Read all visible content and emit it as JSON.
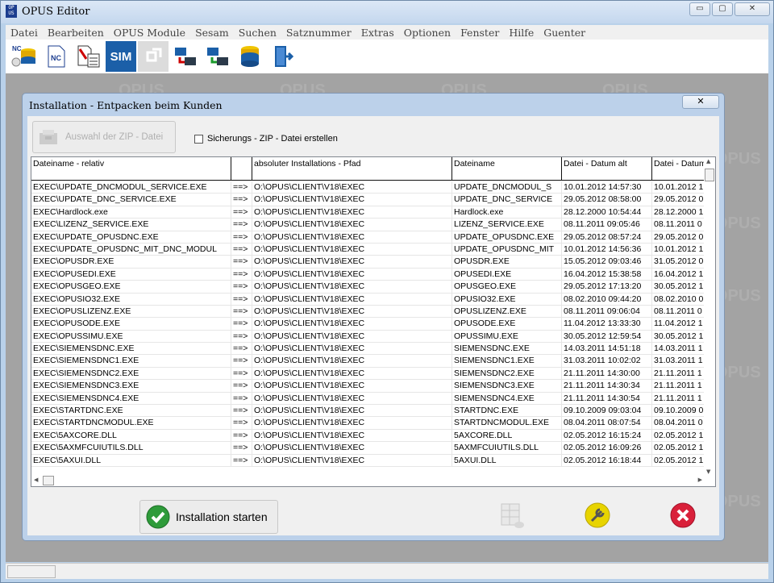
{
  "app": {
    "title": "OPUS Editor"
  },
  "window_buttons": {
    "minimize": "▭",
    "maximize": "▢",
    "close": "✕"
  },
  "menu": [
    "Datei",
    "Bearbeiten",
    "OPUS Module",
    "Sesam",
    "Suchen",
    "Satznummer",
    "Extras",
    "Optionen",
    "Fenster",
    "Hilfe",
    "Guenter"
  ],
  "toolbar": {
    "items": [
      {
        "name": "nc-database-icon",
        "label": "NC"
      },
      {
        "name": "nc-file-icon",
        "label": "NC"
      },
      {
        "name": "nc-code-icon",
        "label": ""
      },
      {
        "name": "sim-icon",
        "label": "SIM"
      },
      {
        "name": "transfer-disabled-icon",
        "label": ""
      },
      {
        "name": "network-send-icon",
        "label": ""
      },
      {
        "name": "network-receive-icon",
        "label": ""
      },
      {
        "name": "database-icon",
        "label": ""
      },
      {
        "name": "exit-icon",
        "label": ""
      }
    ]
  },
  "watermark": "OPUS",
  "dialog": {
    "title": "Installation - Entpacken beim Kunden",
    "close": "✕",
    "zip_button": "Auswahl der ZIP - Datei",
    "checkbox_label": "Sicherungs - ZIP - Datei erstellen",
    "columns": [
      "Dateiname - relativ",
      "",
      "absoluter Installations - Pfad",
      "Dateiname",
      "Datei - Datum alt",
      "Datei - Datum"
    ],
    "rows": [
      [
        "EXEC\\UPDATE_DNCMODUL_SERVICE.EXE",
        "==>",
        "O:\\OPUS\\CLIENT\\V18\\EXEC",
        "UPDATE_DNCMODUL_S",
        "10.01.2012  14:57:30",
        "10.01.2012  1"
      ],
      [
        "EXEC\\UPDATE_DNC_SERVICE.EXE",
        "==>",
        "O:\\OPUS\\CLIENT\\V18\\EXEC",
        "UPDATE_DNC_SERVICE",
        "29.05.2012  08:58:00",
        "29.05.2012  0"
      ],
      [
        "EXEC\\Hardlock.exe",
        "==>",
        "O:\\OPUS\\CLIENT\\V18\\EXEC",
        "Hardlock.exe",
        "28.12.2000  10:54:44",
        "28.12.2000  1"
      ],
      [
        "EXEC\\LIZENZ_SERVICE.EXE",
        "==>",
        "O:\\OPUS\\CLIENT\\V18\\EXEC",
        "LIZENZ_SERVICE.EXE",
        "08.11.2011  09:05:46",
        "08.11.2011  0"
      ],
      [
        "EXEC\\UPDATE_OPUSDNC.EXE",
        "==>",
        "O:\\OPUS\\CLIENT\\V18\\EXEC",
        "UPDATE_OPUSDNC.EXE",
        "29.05.2012  08:57:24",
        "29.05.2012  0"
      ],
      [
        "EXEC\\UPDATE_OPUSDNC_MIT_DNC_MODUL",
        "==>",
        "O:\\OPUS\\CLIENT\\V18\\EXEC",
        "UPDATE_OPUSDNC_MIT",
        "10.01.2012  14:56:36",
        "10.01.2012  1"
      ],
      [
        "EXEC\\OPUSDR.EXE",
        "==>",
        "O:\\OPUS\\CLIENT\\V18\\EXEC",
        "OPUSDR.EXE",
        "15.05.2012  09:03:46",
        "31.05.2012  0"
      ],
      [
        "EXEC\\OPUSEDI.EXE",
        "==>",
        "O:\\OPUS\\CLIENT\\V18\\EXEC",
        "OPUSEDI.EXE",
        "16.04.2012  15:38:58",
        "16.04.2012  1"
      ],
      [
        "EXEC\\OPUSGEO.EXE",
        "==>",
        "O:\\OPUS\\CLIENT\\V18\\EXEC",
        "OPUSGEO.EXE",
        "29.05.2012  17:13:20",
        "30.05.2012  1"
      ],
      [
        "EXEC\\OPUSIO32.EXE",
        "==>",
        "O:\\OPUS\\CLIENT\\V18\\EXEC",
        "OPUSIO32.EXE",
        "08.02.2010  09:44:20",
        "08.02.2010  0"
      ],
      [
        "EXEC\\OPUSLIZENZ.EXE",
        "==>",
        "O:\\OPUS\\CLIENT\\V18\\EXEC",
        "OPUSLIZENZ.EXE",
        "08.11.2011  09:06:04",
        "08.11.2011  0"
      ],
      [
        "EXEC\\OPUSODE.EXE",
        "==>",
        "O:\\OPUS\\CLIENT\\V18\\EXEC",
        "OPUSODE.EXE",
        "11.04.2012  13:33:30",
        "11.04.2012  1"
      ],
      [
        "EXEC\\OPUSSIMU.EXE",
        "==>",
        "O:\\OPUS\\CLIENT\\V18\\EXEC",
        "OPUSSIMU.EXE",
        "30.05.2012  12:59:54",
        "30.05.2012  1"
      ],
      [
        "EXEC\\SIEMENSDNC.EXE",
        "==>",
        "O:\\OPUS\\CLIENT\\V18\\EXEC",
        "SIEMENSDNC.EXE",
        "14.03.2011  14:51:18",
        "14.03.2011  1"
      ],
      [
        "EXEC\\SIEMENSDNC1.EXE",
        "==>",
        "O:\\OPUS\\CLIENT\\V18\\EXEC",
        "SIEMENSDNC1.EXE",
        "31.03.2011  10:02:02",
        "31.03.2011  1"
      ],
      [
        "EXEC\\SIEMENSDNC2.EXE",
        "==>",
        "O:\\OPUS\\CLIENT\\V18\\EXEC",
        "SIEMENSDNC2.EXE",
        "21.11.2011  14:30:00",
        "21.11.2011  1"
      ],
      [
        "EXEC\\SIEMENSDNC3.EXE",
        "==>",
        "O:\\OPUS\\CLIENT\\V18\\EXEC",
        "SIEMENSDNC3.EXE",
        "21.11.2011  14:30:34",
        "21.11.2011  1"
      ],
      [
        "EXEC\\SIEMENSDNC4.EXE",
        "==>",
        "O:\\OPUS\\CLIENT\\V18\\EXEC",
        "SIEMENSDNC4.EXE",
        "21.11.2011  14:30:54",
        "21.11.2011  1"
      ],
      [
        "EXEC\\STARTDNC.EXE",
        "==>",
        "O:\\OPUS\\CLIENT\\V18\\EXEC",
        "STARTDNC.EXE",
        "09.10.2009  09:03:04",
        "09.10.2009  0"
      ],
      [
        "EXEC\\STARTDNCMODUL.EXE",
        "==>",
        "O:\\OPUS\\CLIENT\\V18\\EXEC",
        "STARTDNCMODUL.EXE",
        "08.04.2011  08:07:54",
        "08.04.2011  0"
      ],
      [
        "EXEC\\5AXCORE.DLL",
        "==>",
        "O:\\OPUS\\CLIENT\\V18\\EXEC",
        "5AXCORE.DLL",
        "02.05.2012  16:15:24",
        "02.05.2012  1"
      ],
      [
        "EXEC\\5AXMFCUIUTILS.DLL",
        "==>",
        "O:\\OPUS\\CLIENT\\V18\\EXEC",
        "5AXMFCUIUTILS.DLL",
        "02.05.2012  16:09:26",
        "02.05.2012  1"
      ],
      [
        "EXEC\\5AXUI.DLL",
        "==>",
        "O:\\OPUS\\CLIENT\\V18\\EXEC",
        "5AXUI.DLL",
        "02.05.2012  16:18:44",
        "02.05.2012  1"
      ]
    ],
    "start_button": "Installation starten"
  },
  "colors": {
    "accent": "#1b5fa8",
    "sim_bg": "#1b5fa8",
    "ok_green": "#2e9b3a",
    "cancel_red": "#d9203a",
    "tool_yellow": "#e8d400"
  }
}
